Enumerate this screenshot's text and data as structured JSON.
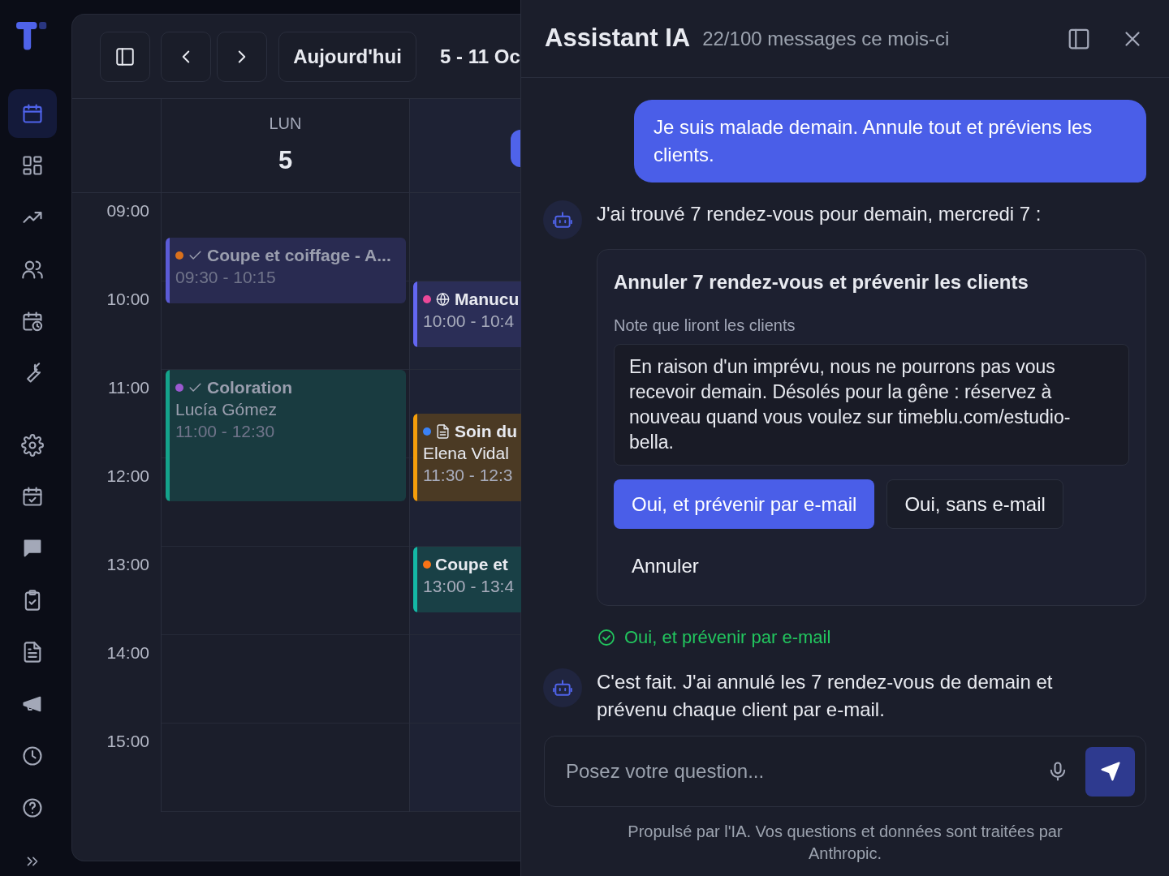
{
  "sidebar": {
    "items": [
      {
        "selected": true
      },
      {
        "selected": false
      },
      {
        "selected": false
      },
      {
        "selected": false
      },
      {
        "selected": false
      },
      {
        "selected": false
      },
      {
        "selected": false
      },
      {
        "selected": false
      },
      {
        "selected": false
      },
      {
        "selected": false
      },
      {
        "selected": false
      },
      {
        "selected": false
      },
      {
        "selected": false
      },
      {
        "selected": false
      }
    ]
  },
  "calendar": {
    "toolbar": {
      "today_button": "Aujourd'hui",
      "range": "5 - 11 Oc"
    },
    "days": [
      {
        "weekday": "LUN",
        "date": "5",
        "today": false,
        "events": [
          {
            "kind": "confirmed",
            "color": "#d9701c",
            "bar": {
              "color": "#5b5bd6"
            },
            "title": "Coupe et coiffage - A...",
            "time": "09:30 - 10:15",
            "past": true
          },
          {
            "kind": "confirmed",
            "color": "#9b59d0",
            "bar": {
              "color": "#14a38b"
            },
            "title": "Coloration",
            "client": "Lucía Gómez",
            "time": "11:00 - 12:30",
            "past": true
          }
        ]
      },
      {
        "today": true,
        "events": [
          {
            "kind": "online",
            "color": "#ec4899",
            "bar": {
              "color": "#6366f1"
            },
            "title": "Manucu",
            "time": "10:00 - 10:4",
            "past": false
          },
          {
            "kind": "note",
            "color": "#3b82f6",
            "bar": {
              "color": "#f59e0b"
            },
            "title": "Soin du",
            "client": "Elena Vidal",
            "time": "11:30 - 12:3",
            "past": false
          },
          {
            "kind": "plain",
            "color": "#f97316",
            "bar": {
              "color": "#14b8a6"
            },
            "title": "Coupe et",
            "time": "13:00 - 13:4",
            "past": false
          }
        ]
      }
    ],
    "hours": [
      "09:00",
      "10:00",
      "11:00",
      "12:00",
      "13:00",
      "14:00",
      "15:00"
    ]
  },
  "assistant": {
    "title": "Assistant IA",
    "usage": "22/100 messages ce mois-ci",
    "messages": [
      {
        "kind": "user",
        "text": "Je suis malade demain. Annule tout et préviens les clients."
      },
      {
        "kind": "bot",
        "text": "J'ai trouvé 7 rendez-vous pour demain, mercredi 7 :"
      },
      {
        "kind": "action",
        "title": "Annuler 7 rendez-vous et prévenir les clients",
        "note_label": "Note que liront les clients",
        "note": "En raison d'un imprévu, nous ne pourrons pas vous recevoir demain. Désolés pour la gêne : réservez à nouveau quand vous voulez sur timeblu.com/estudio-bella.",
        "buttons": [
          {
            "kind": "primary",
            "label": "Oui, et prévenir par e-mail"
          },
          {
            "kind": "outline",
            "label": "Oui, sans e-mail"
          },
          {
            "kind": "ghost",
            "label": "Annuler"
          }
        ]
      },
      {
        "kind": "result",
        "text": "Oui, et prévenir par e-mail"
      },
      {
        "kind": "bot",
        "text": "C'est fait. J'ai annulé les 7 rendez-vous de demain et prévenu chaque client par e-mail."
      }
    ],
    "input": {
      "placeholder": "Posez votre question..."
    },
    "footer": "Propulsé par l'IA. Vos questions et données sont traitées par Anthropic."
  }
}
